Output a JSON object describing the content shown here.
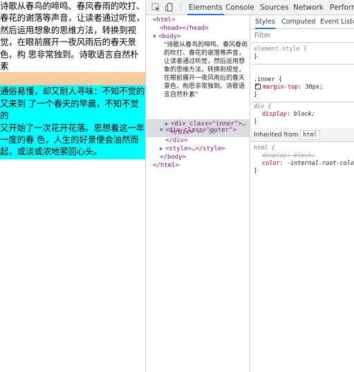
{
  "page": {
    "intro_text": "诗歌从春鸟的啼鸣、春风春雨的吹打、\n春花的谢落等声音，让读者通过听觉，\n然后运用想象的思维方法，转换到视\n觉，在眼前展开一夜风雨后的春天景\n色，构 思非常独到。诗歌语言自然朴素",
    "inner_text": "通俗易懂，却又耐人寻味：不知不觉的\n又来到 了一个春天的早晨，不知不觉的\n又开始了一次花开花落。思想着这一年\n一度的春 色，人生的好景便会油然而\n起，或淡或浓地萦回心头。",
    "margin_color": "#f9cc9d",
    "inner_color": "#00ffff"
  },
  "devtools": {
    "tabs": [
      "Elements",
      "Console",
      "Sources",
      "Network",
      "Performa"
    ],
    "active_tab": "Elements",
    "icons": [
      "inspect-icon",
      "device-toolbar-icon"
    ],
    "tree": {
      "html_open": "<html>",
      "head": "<head></head>",
      "body_open": "<body>",
      "body_text": "\"诗歌从春鸟的啼鸣、春风春雨的吹打、春花的谢落等声音，让读者通过听觉，然后运用想象的思维方法，转换到视觉，在眼前展开一夜风雨后的春天景色，构思非常独到。诗歌语言自然朴素\"",
      "div_outer_open": "<div class=\"outer\">",
      "div_inner": "<div class=\"inner\">…",
      "div_close_selected": "</div>",
      "dollar0": "== $0",
      "div_close": "</div>",
      "style": "<style>…</style>",
      "body_close": "</body>",
      "html_close": "</html>"
    },
    "styles_tabs": [
      "Styles",
      "Computed",
      "Event Listene"
    ],
    "active_styles_tab": "Styles",
    "filter_placeholder": "Filter",
    "rules": {
      "element_style_selector": "element.style {",
      "close_brace": "}",
      "inner_selector": ".inner {",
      "inner_prop_name": "margin-top",
      "inner_prop_value": "30px;",
      "div_selector": "div {",
      "div_prop_name": "display",
      "div_prop_value": "block;",
      "inherited_label": "Inherited from",
      "inherited_tag": "html",
      "html_selector": "html {",
      "html_prop1_name": "display",
      "html_prop1_value": "block;",
      "html_prop2_name": "color",
      "html_prop2_value": "-internal-root-color"
    }
  }
}
